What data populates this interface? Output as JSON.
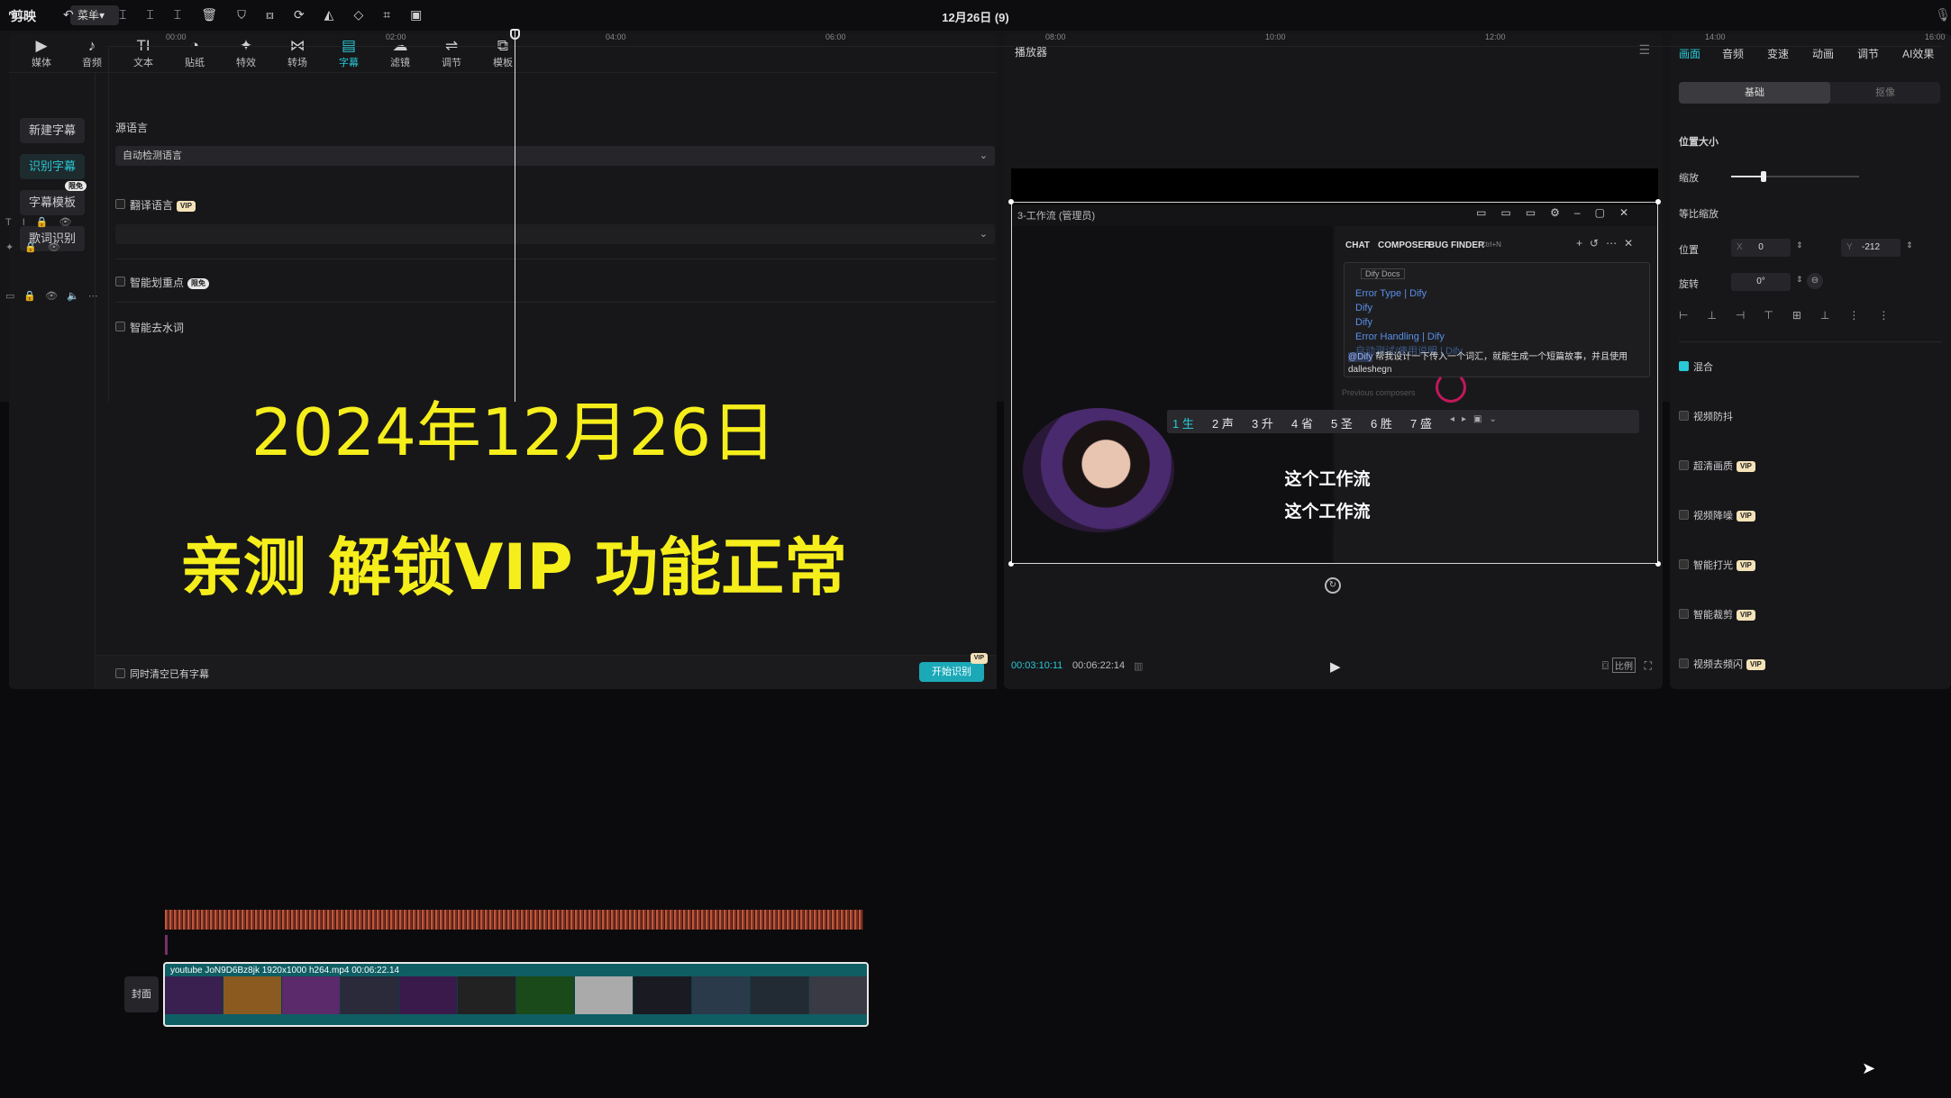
{
  "app": {
    "logo": "剪映",
    "menu": "菜单▾",
    "window_title": "12月26日 (9)"
  },
  "toolbar": [
    {
      "icon": "▶",
      "label": "媒体"
    },
    {
      "icon": "♪",
      "label": "音频"
    },
    {
      "icon": "TI",
      "label": "文本"
    },
    {
      "icon": "◔",
      "label": "贴纸"
    },
    {
      "icon": "✦",
      "label": "特效"
    },
    {
      "icon": "⋈",
      "label": "转场"
    },
    {
      "icon": "▤",
      "label": "字幕"
    },
    {
      "icon": "☁",
      "label": "滤镜"
    },
    {
      "icon": "⇌",
      "label": "调节"
    },
    {
      "icon": "⧉",
      "label": "模板"
    }
  ],
  "subnav": {
    "new": "新建字幕",
    "recognize": "识别字幕",
    "template": "字幕模板",
    "template_badge": "限免",
    "lyrics": "歌词识别"
  },
  "caption_panel": {
    "source_lang_label": "源语言",
    "source_lang_value": "自动检测语言",
    "translate_label": "翻译语言",
    "translate_badge": "VIP",
    "smart_split_label": "智能划重点",
    "smart_split_badge": "限免",
    "remove_filler_label": "智能去水词",
    "clear_existing_label": "同时清空已有字幕",
    "start_btn": "开始识别",
    "start_badge": "VIP",
    "overlay_line1": "2024年12月26日",
    "overlay_line2": "亲测 解锁VIP 功能正常"
  },
  "player": {
    "title": "播放器",
    "current_time": "00:03:10:11",
    "total_time": "00:06:22:14",
    "ratio": "比例",
    "inner": {
      "window_title": "3-工作流 (管理员)",
      "tabs": [
        "CHAT",
        "COMPOSER",
        "BUG FINDER"
      ],
      "shortcut": "Ctrl+N",
      "docs_chip": "Dify Docs",
      "links": [
        "Error Type | Dify",
        "Dify",
        "Dify",
        "Error Handling | Dify",
        "自动测试/使用说明 | Dify"
      ],
      "prompt_tag": "@Dify",
      "prompt_text": "帮我设计一下传入一个词汇，就能生成一个短篇故事，并且使用dalleshegn",
      "ime_candidates": [
        "1 生",
        "2 声",
        "3 升",
        "4 省",
        "5 圣",
        "6 胜",
        "7 盛"
      ],
      "previous": "Previous composers",
      "caption_top": "这个工作流",
      "caption_bottom": "这个工作流"
    }
  },
  "right_panel": {
    "tabs": [
      "画面",
      "音频",
      "变速",
      "动画",
      "调节",
      "AI效果"
    ],
    "seg": [
      "基础",
      "抠像"
    ],
    "position_size": "位置大小",
    "scale": "缩放",
    "scale_value": 0.25,
    "uniform_scale": "等比缩放",
    "position": "位置",
    "x_label": "X",
    "x_value": "0",
    "y_label": "Y",
    "y_value": "-212",
    "rotate": "旋转",
    "rotate_value": "0°",
    "blend": "混合",
    "stabilize": "视频防抖",
    "hd": "超清画质",
    "denoise": "视频降噪",
    "smart_light": "智能打光",
    "smart_crop": "智能裁剪",
    "deflicker": "视频去频闪",
    "vip": "VIP"
  },
  "timeline": {
    "ruler_labels": [
      "00:00",
      "02:00",
      "04:00",
      "06:00",
      "08:00",
      "10:00",
      "12:00",
      "14:00",
      "16:00"
    ],
    "clip_title": "youtube JoN9D6Bz8jk 1920x1000 h264.mp4   00:06:22.14",
    "cover": "封面"
  }
}
